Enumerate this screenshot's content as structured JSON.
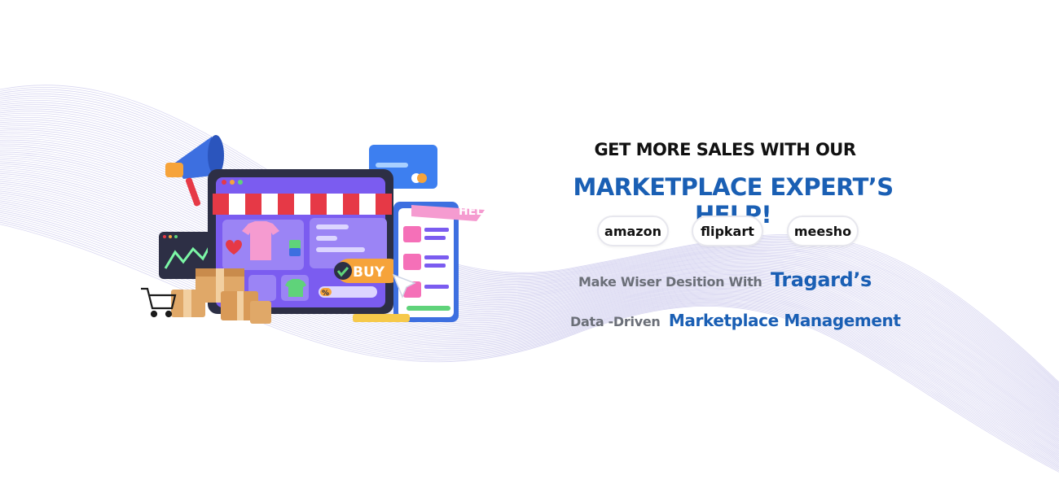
{
  "colors": {
    "background": "#ffffff",
    "headline_dark": "#111111",
    "brand_blue": "#1a5fb4",
    "muted_text": "#6b6f78",
    "wave_lines": "#b9b6e6",
    "store_purple": "#7b5cf0",
    "awning_red": "#e63946",
    "buy_orange": "#f6a33a"
  },
  "hero": {
    "headline_top": "GET MORE SALES WITH OUR",
    "headline_main": "MARKETPLACE EXPERT’S HELP!",
    "marketplaces": [
      "amazon",
      "flipkart",
      "meesho"
    ],
    "line1_prefix": "Make Wiser Desition With",
    "line1_brand": "Tragard’s",
    "line2_prefix": "Data -Driven",
    "line2_accent": "Marketplace Management"
  },
  "illustration": {
    "buy_label": "BUY",
    "percent_label": "%",
    "partial_sign_text": "HEL",
    "icons": [
      "megaphone-icon",
      "credit-card-icon",
      "shopping-cart-icon",
      "heart-icon",
      "tshirt-icon",
      "checkmark-icon",
      "cursor-icon",
      "box-icon",
      "chart-icon"
    ]
  }
}
